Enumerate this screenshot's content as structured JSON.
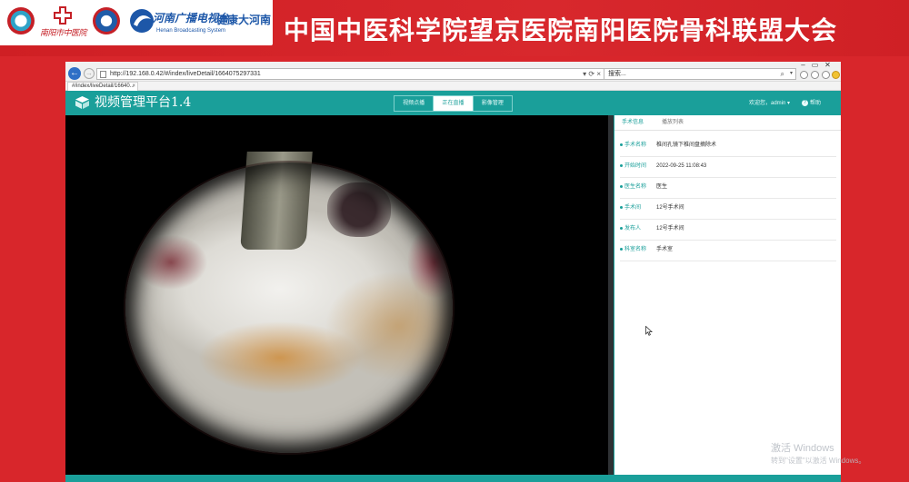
{
  "banner": {
    "event_title": "中国中医科学院望京医院南阳医院骨科联盟大会",
    "logo2_caption": "南阳市中医院",
    "logo4_title": "河南广播电视台",
    "logo4_subtitle": "Henan Broadcasting System",
    "logo4_brand": "健康大河南"
  },
  "browser": {
    "url": "http://192.168.0.42/#/index/liveDetail/1664075297331",
    "url_tools": "▾ ⟳ ×",
    "search_placeholder": "搜索...",
    "search_icon_glyph": "⌕",
    "dropdown_glyph": "▾",
    "tab_title": "#/index/liveDetail/16640...",
    "tab_close": "×",
    "back_glyph": "←",
    "forward_glyph": "→",
    "window_buttons": [
      "–",
      "▭",
      "✕"
    ]
  },
  "app": {
    "title": "视频管理平台1.4",
    "nav_tabs": [
      {
        "label": "视频点播"
      },
      {
        "label": "正在直播"
      },
      {
        "label": "影像管理"
      }
    ],
    "active_tab": "正在直播",
    "user_greeting": "欢迎您，admin ▾",
    "help_label": "帮助",
    "help_glyph": "?",
    "accent_color": "#1a9f9a"
  },
  "info_panel": {
    "tabs": [
      "手术信息",
      "播放列表"
    ],
    "active_tab": "手术信息",
    "rows": [
      {
        "label": "手术名称",
        "value": "椎间孔镜下椎间盘摘除术"
      },
      {
        "label": "开始时间",
        "value": "2022-09-25 11:08:43"
      },
      {
        "label": "医生名称",
        "value": "医生"
      },
      {
        "label": "手术间",
        "value": "12号手术间"
      },
      {
        "label": "发布人",
        "value": "12号手术间"
      },
      {
        "label": "科室名称",
        "value": "手术室"
      }
    ]
  },
  "os_watermark": {
    "line1": "激活 Windows",
    "line2": "转到\"设置\"以激活 Windows。"
  },
  "icons": {
    "hospital_logos": [
      "hospital-logo-icon",
      "red-cross-icon",
      "hospital-emblem-icon",
      "tv-station-icon"
    ],
    "app_logo": "cube-logo-icon",
    "cursor": "mouse-cursor-icon"
  }
}
